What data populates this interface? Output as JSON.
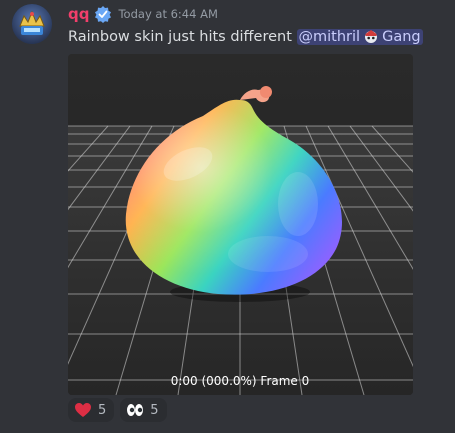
{
  "message": {
    "author": "qq",
    "timestamp": "Today at 6:44 AM",
    "text": "Rainbow skin just hits different",
    "mention": "@mithril",
    "mention_suffix": "Gang"
  },
  "embed": {
    "caption": "0:00 (000.0%) Frame 0"
  },
  "reactions": [
    {
      "emoji": "heart",
      "count": "5"
    },
    {
      "emoji": "eyes",
      "count": "5"
    }
  ]
}
